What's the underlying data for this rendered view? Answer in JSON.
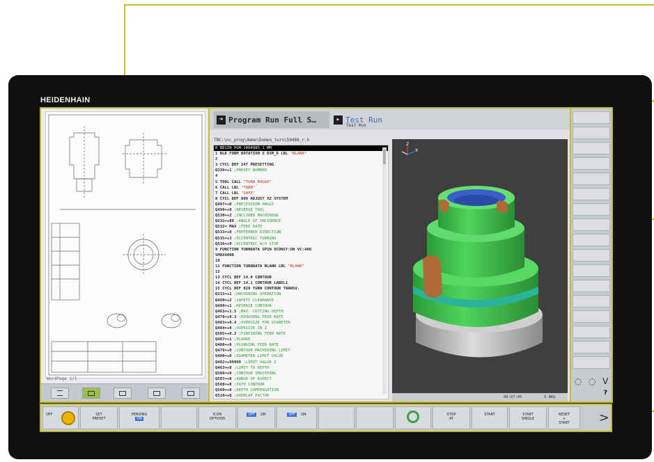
{
  "brand": "HEIDENHAIN",
  "colors": {
    "callout": "#c3bd2b",
    "bezel": "#101010",
    "tab_link": "#3c6fb3",
    "comment_green": "#2f9a2f",
    "string_red": "#c0302a",
    "model_green": "#37c64a",
    "model_blue": "#3b5fc8",
    "model_teal": "#2bb39a",
    "model_grey": "#b9b9b9"
  },
  "drawing_viewer": {
    "footer": "WordPage 1/1",
    "toolbar": [
      {
        "icon": "menu-icon",
        "active": false
      },
      {
        "icon": "fit-page-icon",
        "active": true
      },
      {
        "icon": "image-icon",
        "active": false
      },
      {
        "icon": "page-prev-icon",
        "active": false
      },
      {
        "icon": "page-next-icon",
        "active": false
      }
    ]
  },
  "tabs": {
    "program_run": "Program Run Full S…",
    "test_run": "Test Run",
    "test_run_sub": "Test Run"
  },
  "program": {
    "path": "TNC:\\nc_prog\\demo\\Domen_turn\\59486_r.h",
    "lines": [
      {
        "t": "0  BEGIN PGM 1004985_1 MM",
        "sel": true
      },
      {
        "t": "1  BLK FORM ROTATION Z DIM_D LBL \"BLANK\""
      },
      {
        "t": "2"
      },
      {
        "t": "3  CYCL DEF 247 PRESETTING"
      },
      {
        "t": "     Q339=+1    ;PRESET NUMBER"
      },
      {
        "t": "4"
      },
      {
        "t": "5  TOOL CALL \"TURN_ROUGH\""
      },
      {
        "t": "6  CALL LBL \"TURN\""
      },
      {
        "t": "7  CALL LBL \"SAFE\""
      },
      {
        "t": "8  CYCL DEF 800 ADJUST XZ SYSTEM"
      },
      {
        "t": "     Q497=+0    ;PRECESSION ANGLE"
      },
      {
        "t": "     Q498=+0    ;REVERSE TOOL"
      },
      {
        "t": "     Q530=+2    ;INCLINED MACHINING"
      },
      {
        "t": "     Q531=+88   ;ANGLE OF INCIDENCE"
      },
      {
        "t": "     Q532= MAX  ;FEED RATE"
      },
      {
        "t": "     Q533=+0    ;PREFERRED DIRECTION"
      },
      {
        "t": "     Q535=+3    ;ECCENTRIC TURNING"
      },
      {
        "t": "     Q536=+0    ;ECCENTRIC W/O STOP"
      },
      {
        "t": "9  FUNCTION TURNDATA SPIN VCONST:ON VC:400"
      },
      {
        "t": "SMAX4000"
      },
      {
        "t": "10"
      },
      {
        "t": "11 FUNCTION TURNDATA BLANK LBL \"BLANK\""
      },
      {
        "t": "12"
      },
      {
        "t": "13 CYCL DEF 14.0 CONTOUR"
      },
      {
        "t": "14 CYCL DEF 14.1 CONTOUR LABEL1"
      },
      {
        "t": "15 CYCL DEF 820 TURN CONTOUR TRANSV."
      },
      {
        "t": "     Q215=+1    ;MACHINING OPERATION"
      },
      {
        "t": "     Q460=+2    ;SAFETY CLEARANCE"
      },
      {
        "t": "     Q499=+1    ;REVERSE CONTOUR"
      },
      {
        "t": "     Q463=+1.5  ;MAX. CUTTING DEPTH"
      },
      {
        "t": "     Q478=+0.3  ;ROUGHING FEED RATE"
      },
      {
        "t": "     Q483=+0.4  ;OVERSIZE FOR DIAMETER"
      },
      {
        "t": "     Q484=+0    ;OVERSIZE IN Z"
      },
      {
        "t": "     Q505=+0.2  ;FINISHING FEED RATE"
      },
      {
        "t": "     Q487=+1    ;PLUNGE"
      },
      {
        "t": "     Q488=+0    ;PLUNGING FEED RATE"
      },
      {
        "t": "     Q479=+0    ;CONTOUR MACHINING LIMIT"
      },
      {
        "t": "     Q480=+0    ;DIAMETER LIMIT VALUE"
      },
      {
        "t": "     Q482=+99999 ;LIMIT VALUE Z"
      },
      {
        "t": "     Q463=+0    ;LIMIT TO DEPTH"
      },
      {
        "t": "     Q506=+0    ;CONTOUR SMOOTHING"
      },
      {
        "t": "     Q507=+0    ;RANGE OF ASPECT"
      },
      {
        "t": "     Q508=+0    ;PATH CONTOUR"
      },
      {
        "t": "     Q509=+0    ;DEPTH COMPENSATION"
      },
      {
        "t": "     Q510=+0    ;OVERLAP FACTOR"
      }
    ]
  },
  "simulation": {
    "axes": {
      "x": "X",
      "y": "Y",
      "z": "Z"
    },
    "status_time": "00:07:05",
    "status_count": "5 BKG"
  },
  "right_softkeys": [
    "",
    "",
    "",
    "",
    "",
    "",
    "",
    "",
    "",
    "",
    "",
    "",
    "",
    "",
    "",
    "",
    ""
  ],
  "right_nav": {
    "prev": "◌",
    "next": "◌",
    "down": "V",
    "help": "?"
  },
  "bottom_softkeys": [
    {
      "id": "off",
      "lines": [
        "OFF"
      ]
    },
    {
      "id": "set-preset",
      "lines": [
        "SET",
        "PRESET"
      ]
    },
    {
      "id": "pending",
      "lines": [
        "PENDING"
      ],
      "pill": "ON"
    },
    {
      "id": "blank1",
      "lines": []
    },
    {
      "id": "icon-options",
      "lines": [
        "ICON",
        "OPTIONS"
      ]
    },
    {
      "id": "toggle-a",
      "lines": [
        ""
      ],
      "pill": "OFF",
      "state": "ON"
    },
    {
      "id": "toggle-b",
      "lines": [
        ""
      ],
      "pill": "OFF",
      "state": "ON"
    },
    {
      "id": "blank2",
      "lines": []
    },
    {
      "id": "blank3",
      "lines": []
    },
    {
      "id": "override",
      "lines": []
    },
    {
      "id": "stop-at",
      "lines": [
        "STOP",
        "AT"
      ]
    },
    {
      "id": "start",
      "lines": [
        "START"
      ]
    },
    {
      "id": "start-single",
      "lines": [
        "START",
        "SINGLE"
      ]
    },
    {
      "id": "reset-start",
      "lines": [
        "RESET",
        "+",
        "START"
      ]
    }
  ],
  "bottom_arrow": ">"
}
